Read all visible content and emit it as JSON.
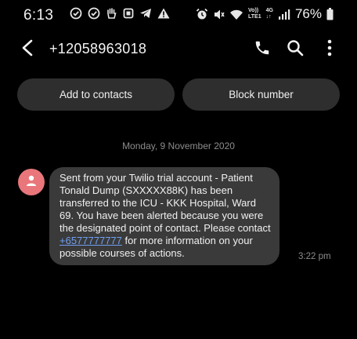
{
  "status_bar": {
    "time": "6:13",
    "left_icons": [
      "check-circle-icon",
      "check-circle-icon",
      "hand-icon",
      "square-icon",
      "telegram-icon",
      "warning-icon"
    ],
    "alarm_icon": "alarm-icon",
    "mute_icon": "mute-icon",
    "wifi_icon": "wifi-icon",
    "volte_top": "Vo))",
    "volte_bottom": "LTE1",
    "network_top": "4G",
    "network_bottom": "↓↑",
    "signal_icon": "signal-icon",
    "battery_percent": "76%",
    "battery_icon": "battery-icon"
  },
  "header": {
    "contact_number": "+12058963018",
    "icons": [
      "back-arrow-icon",
      "phone-icon",
      "search-icon",
      "more-vertical-icon"
    ]
  },
  "actions": {
    "add_to_contacts": "Add to contacts",
    "block_number": "Block number"
  },
  "conversation": {
    "date": "Monday, 9 November 2020",
    "message": {
      "text_before_link": "Sent from your Twilio trial account - Patient Tonald Dump (SXXXXX88K) has been transferred to the ICU - KKK Hospital, Ward 69. You have been alerted because you were the designated point of contact. Please contact ",
      "link": "+6577777777",
      "text_after_link": " for more information on your possible courses of actions.",
      "time": "3:22 pm"
    }
  },
  "colors": {
    "background": "#000000",
    "button_bg": "#2e2e2e",
    "bubble_bg": "#3a3a3a",
    "avatar_bg": "#e8767a",
    "link": "#6f9ff2",
    "muted_text": "#8c8c8c"
  }
}
